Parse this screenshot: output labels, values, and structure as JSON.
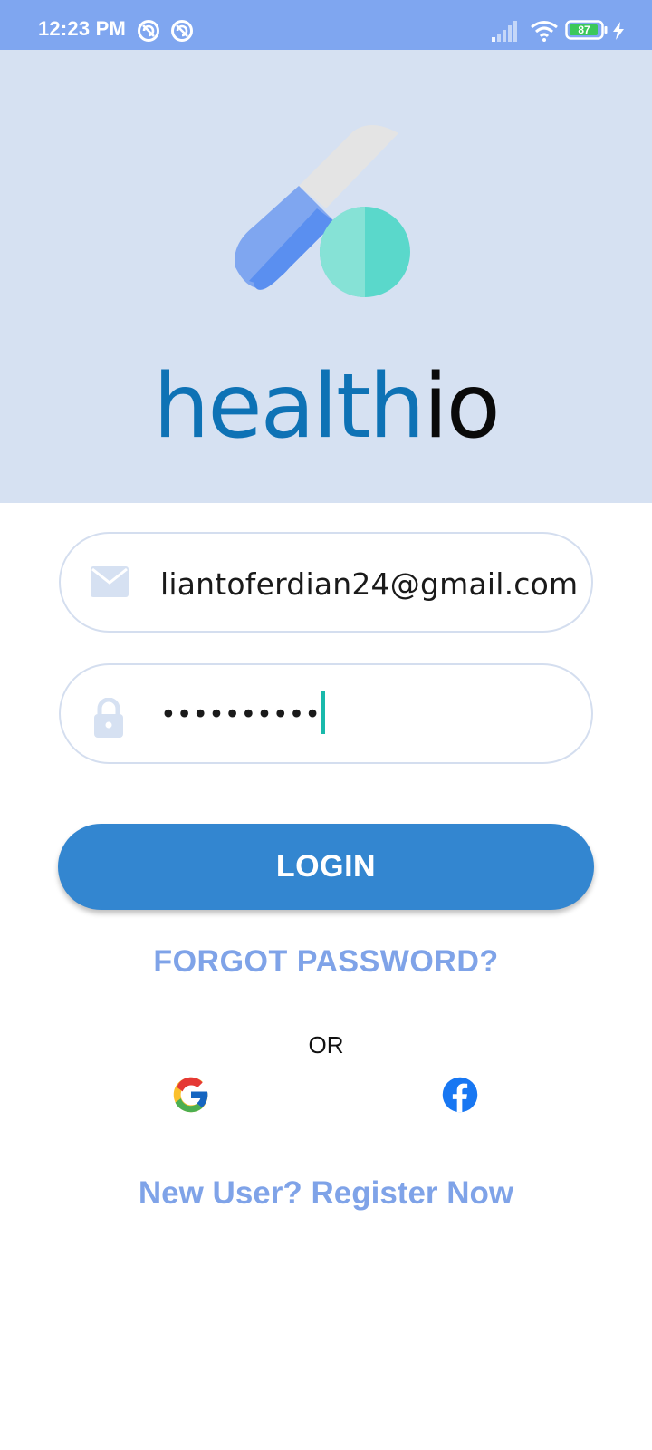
{
  "status_bar": {
    "time": "12:23 PM",
    "battery": "87",
    "icons": [
      "notification-icon",
      "notification-icon",
      "signal-icon",
      "wifi-icon",
      "battery-icon",
      "charging-icon"
    ]
  },
  "brand": {
    "part1": "health",
    "part2": "io"
  },
  "form": {
    "email_value": "liantoferdian24@gmail.com",
    "password_mask": "••••••••••",
    "email_icon": "mail-icon",
    "password_icon": "lock-icon"
  },
  "actions": {
    "login_label": "LOGIN",
    "forgot_label": "FORGOT PASSWORD?",
    "or_label": "OR",
    "register_label": "New User? Register Now",
    "social": [
      "google-icon",
      "facebook-icon"
    ]
  },
  "colors": {
    "status_bar": "#7fa6f0",
    "header_bg": "#d6e1f2",
    "primary": "#3386d0",
    "link": "#7fa3e8",
    "brand_blue": "#0e72b5",
    "caret": "#19b9ab"
  }
}
